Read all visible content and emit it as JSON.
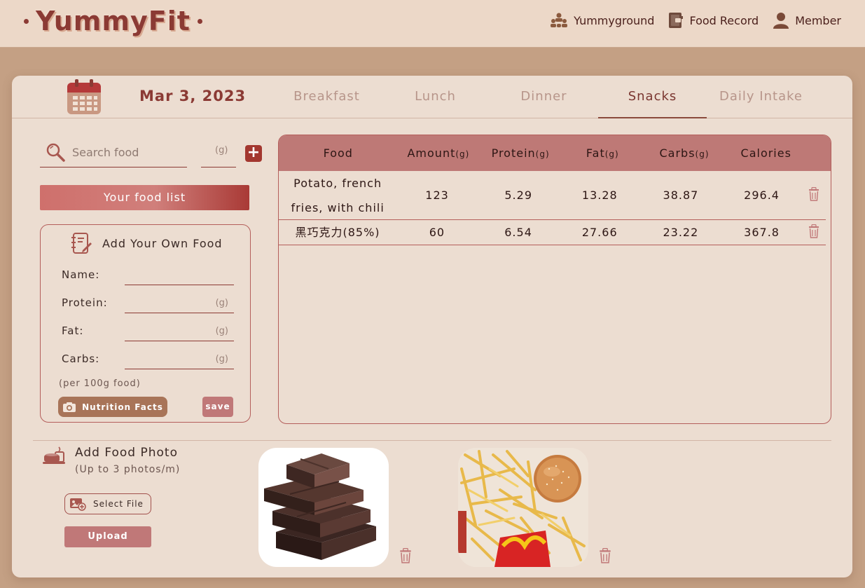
{
  "header": {
    "logo": "YummyFit",
    "nav": [
      {
        "label": "Yummyground",
        "icon": "group-icon"
      },
      {
        "label": "Food Record",
        "icon": "notebook-icon"
      },
      {
        "label": "Member",
        "icon": "person-icon"
      }
    ]
  },
  "date": "Mar 3, 2023",
  "tabs": [
    {
      "label": "Breakfast",
      "active": false
    },
    {
      "label": "Lunch",
      "active": false
    },
    {
      "label": "Dinner",
      "active": false
    },
    {
      "label": "Snacks",
      "active": true
    },
    {
      "label": "Daily Intake",
      "active": false
    }
  ],
  "search": {
    "placeholder": "Search food",
    "gram_unit": "(g)",
    "add_label": "+"
  },
  "food_list_button": "Your food list",
  "own_food": {
    "title": "Add Your Own Food",
    "name_label": "Name:",
    "protein_label": "Protein:",
    "fat_label": "Fat:",
    "carbs_label": "Carbs:",
    "unit": "(g)",
    "note": "(per 100g food)",
    "nutrition_button": "Nutrition Facts",
    "save_button": "save"
  },
  "table": {
    "headers": {
      "food": "Food",
      "amount": "Amount",
      "protein": "Protein",
      "fat": "Fat",
      "carbs": "Carbs",
      "calories": "Calories",
      "unit": "(g)"
    },
    "rows": [
      {
        "food": "Potato, french fries, with chili",
        "amount": "123",
        "protein": "5.29",
        "fat": "13.28",
        "carbs": "38.87",
        "calories": "296.4"
      },
      {
        "food": "黑巧克力(85%)",
        "amount": "60",
        "protein": "6.54",
        "fat": "27.66",
        "carbs": "23.22",
        "calories": "367.8"
      }
    ]
  },
  "photo_section": {
    "title": "Add Food Photo",
    "subtitle": "(Up to 3 photos/m)",
    "select_button": "Select File",
    "upload_button": "Upload"
  },
  "colors": {
    "brand": "#8b3a34",
    "page_bg": "#c4a084",
    "card_bg": "#ecddd1",
    "table_header": "#be7976"
  }
}
